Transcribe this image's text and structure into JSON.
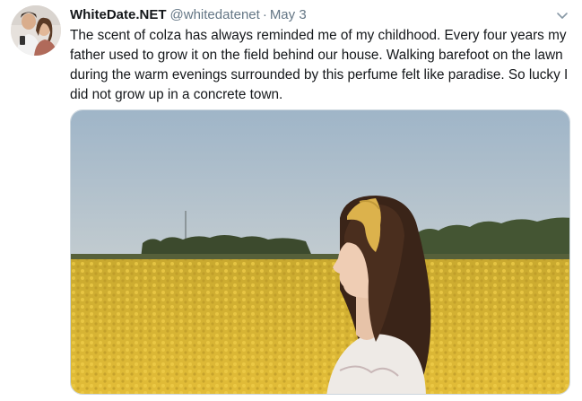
{
  "tweet": {
    "display_name": "WhiteDate.NET",
    "handle": "@whitedatenet",
    "separator": "·",
    "date": "May 3",
    "text": "The scent of colza has always reminded me of my childhood. Every four years my father used to grow it on the field behind our house. Walking barefoot on the lawn during the warm evenings surrounded by this perfume felt like paradise. So lucky I did not grow up in a concrete town.",
    "caret_icon": "chevron-down-icon",
    "avatar_icon": "profile-photo",
    "media_description_icon": "photo-woman-in-rapeseed-field"
  },
  "colors": {
    "name": "#14171a",
    "muted": "#657786",
    "sky": "#a9bccd",
    "field": "#dcb632",
    "trees": "#3b4a2c"
  }
}
